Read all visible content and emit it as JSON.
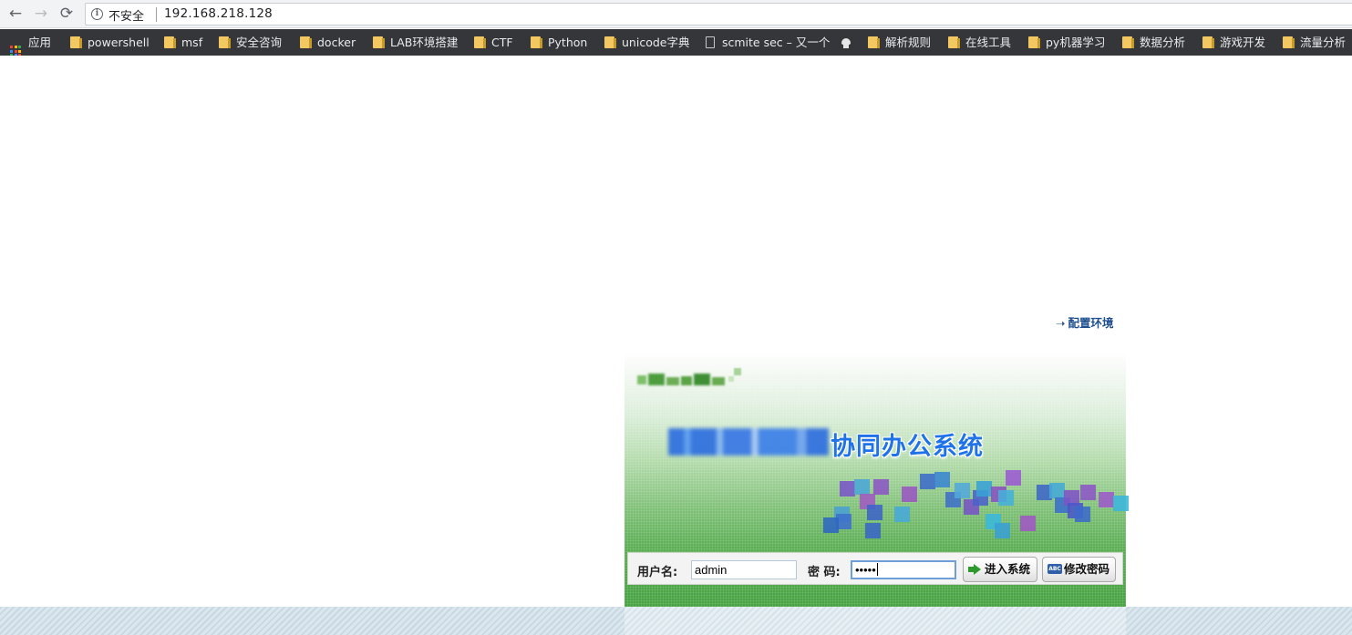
{
  "browser": {
    "security_label": "不安全",
    "url": "192.168.218.128",
    "nav": {
      "back": "←",
      "forward": "→",
      "reload": "⟳"
    },
    "bookmarks": [
      {
        "label": "应用",
        "icon": "apps-grid-icon"
      },
      {
        "label": "powershell",
        "icon": "folder-icon"
      },
      {
        "label": "msf",
        "icon": "folder-icon"
      },
      {
        "label": "安全咨询",
        "icon": "folder-icon"
      },
      {
        "label": "docker",
        "icon": "folder-icon"
      },
      {
        "label": "LAB环境搭建",
        "icon": "folder-icon"
      },
      {
        "label": "CTF",
        "icon": "folder-icon"
      },
      {
        "label": "Python",
        "icon": "folder-icon"
      },
      {
        "label": "unicode字典",
        "icon": "folder-icon"
      },
      {
        "label": "scmite sec – 又一个",
        "icon": "page-icon"
      },
      {
        "label": "",
        "icon": "hat-icon"
      },
      {
        "label": "解析规则",
        "icon": "folder-icon"
      },
      {
        "label": "在线工具",
        "icon": "folder-icon"
      },
      {
        "label": "py机器学习",
        "icon": "folder-icon"
      },
      {
        "label": "数据分析",
        "icon": "folder-icon"
      },
      {
        "label": "游戏开发",
        "icon": "folder-icon"
      },
      {
        "label": "流量分析",
        "icon": "folder-icon"
      }
    ]
  },
  "page": {
    "config_link": "配置环境",
    "config_arrow": "➝",
    "system_title": "协同办公系统",
    "form": {
      "username_label": "用户名:",
      "username_value": "admin",
      "password_label": "密 码:",
      "password_value": "•••••",
      "login_button": "进入系统",
      "change_password_button": "修改密码",
      "change_password_icon_text": "ABC"
    }
  },
  "colors": {
    "title_blue": "#1f72e8",
    "config_link": "#1f4f8f",
    "panel_green": "#46a241",
    "bookmark_bar": "#35363a"
  }
}
